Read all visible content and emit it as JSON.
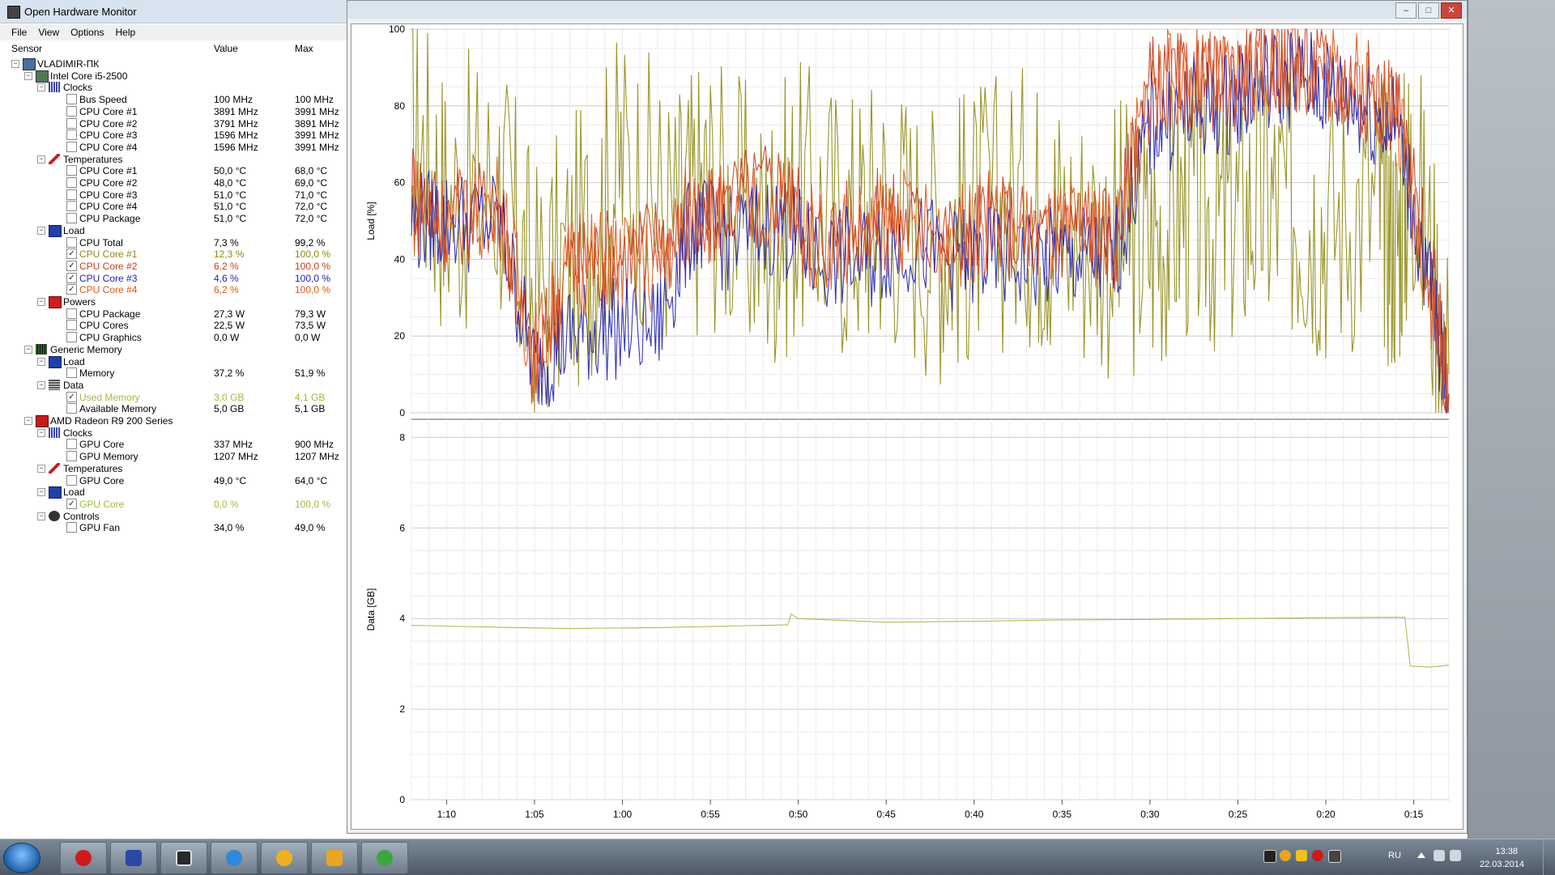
{
  "window": {
    "title": "Open Hardware Monitor"
  },
  "menu": [
    "File",
    "View",
    "Options",
    "Help"
  ],
  "columns": {
    "sensor": "Sensor",
    "value": "Value",
    "max": "Max"
  },
  "tree": [
    {
      "level": 0,
      "kind": "node",
      "icon": "computer-icon",
      "label": "VLADIMIR-ПК",
      "value": "",
      "max": ""
    },
    {
      "level": 1,
      "kind": "node",
      "icon": "cpu-icon",
      "label": "Intel Core i5-2500",
      "value": "",
      "max": ""
    },
    {
      "level": 2,
      "kind": "node",
      "icon": "clock-icon",
      "label": "Clocks",
      "value": "",
      "max": ""
    },
    {
      "level": 3,
      "kind": "leaf",
      "checked": false,
      "color": "",
      "label": "Bus Speed",
      "value": "100 MHz",
      "max": "100 MHz"
    },
    {
      "level": 3,
      "kind": "leaf",
      "checked": false,
      "color": "",
      "label": "CPU Core #1",
      "value": "3891 MHz",
      "max": "3991 MHz"
    },
    {
      "level": 3,
      "kind": "leaf",
      "checked": false,
      "color": "",
      "label": "CPU Core #2",
      "value": "3791 MHz",
      "max": "3891 MHz"
    },
    {
      "level": 3,
      "kind": "leaf",
      "checked": false,
      "color": "",
      "label": "CPU Core #3",
      "value": "1596 MHz",
      "max": "3991 MHz"
    },
    {
      "level": 3,
      "kind": "leaf",
      "checked": false,
      "color": "",
      "label": "CPU Core #4",
      "value": "1596 MHz",
      "max": "3991 MHz"
    },
    {
      "level": 2,
      "kind": "node",
      "icon": "thermometer-icon",
      "label": "Temperatures",
      "value": "",
      "max": ""
    },
    {
      "level": 3,
      "kind": "leaf",
      "checked": false,
      "color": "",
      "label": "CPU Core #1",
      "value": "50,0 °C",
      "max": "68,0 °C"
    },
    {
      "level": 3,
      "kind": "leaf",
      "checked": false,
      "color": "",
      "label": "CPU Core #2",
      "value": "48,0 °C",
      "max": "69,0 °C"
    },
    {
      "level": 3,
      "kind": "leaf",
      "checked": false,
      "color": "",
      "label": "CPU Core #3",
      "value": "51,0 °C",
      "max": "71,0 °C"
    },
    {
      "level": 3,
      "kind": "leaf",
      "checked": false,
      "color": "",
      "label": "CPU Core #4",
      "value": "51,0 °C",
      "max": "72,0 °C"
    },
    {
      "level": 3,
      "kind": "leaf",
      "checked": false,
      "color": "",
      "label": "CPU Package",
      "value": "51,0 °C",
      "max": "72,0 °C"
    },
    {
      "level": 2,
      "kind": "node",
      "icon": "load-icon",
      "label": "Load",
      "value": "",
      "max": ""
    },
    {
      "level": 3,
      "kind": "leaf",
      "checked": false,
      "color": "",
      "label": "CPU Total",
      "value": "7,3 %",
      "max": "99,2 %"
    },
    {
      "level": 3,
      "kind": "leaf",
      "checked": true,
      "color": "#8f8a12",
      "label": "CPU Core #1",
      "value": "12,3 %",
      "max": "100,0 %"
    },
    {
      "level": 3,
      "kind": "leaf",
      "checked": true,
      "color": "#c83b1e",
      "label": "CPU Core #2",
      "value": "6,2 %",
      "max": "100,0 %"
    },
    {
      "level": 3,
      "kind": "leaf",
      "checked": true,
      "color": "#2222b0",
      "label": "CPU Core #3",
      "value": "4,6 %",
      "max": "100,0 %"
    },
    {
      "level": 3,
      "kind": "leaf",
      "checked": true,
      "color": "#e0561a",
      "label": "CPU Core #4",
      "value": "6,2 %",
      "max": "100,0 %"
    },
    {
      "level": 2,
      "kind": "node",
      "icon": "power-icon",
      "label": "Powers",
      "value": "",
      "max": ""
    },
    {
      "level": 3,
      "kind": "leaf",
      "checked": false,
      "color": "",
      "label": "CPU Package",
      "value": "27,3 W",
      "max": "79,3 W"
    },
    {
      "level": 3,
      "kind": "leaf",
      "checked": false,
      "color": "",
      "label": "CPU Cores",
      "value": "22,5 W",
      "max": "73,5 W"
    },
    {
      "level": 3,
      "kind": "leaf",
      "checked": false,
      "color": "",
      "label": "CPU Graphics",
      "value": "0,0 W",
      "max": "0,0 W"
    },
    {
      "level": 1,
      "kind": "node",
      "icon": "ram-icon",
      "label": "Generic Memory",
      "value": "",
      "max": ""
    },
    {
      "level": 2,
      "kind": "node",
      "icon": "load-icon",
      "label": "Load",
      "value": "",
      "max": ""
    },
    {
      "level": 3,
      "kind": "leaf",
      "checked": false,
      "color": "",
      "label": "Memory",
      "value": "37,2 %",
      "max": "51,9 %"
    },
    {
      "level": 2,
      "kind": "node",
      "icon": "data-icon",
      "label": "Data",
      "value": "",
      "max": ""
    },
    {
      "level": 3,
      "kind": "leaf",
      "checked": true,
      "color": "#9bbd3c",
      "label": "Used Memory",
      "value": "3,0 GB",
      "max": "4,1 GB"
    },
    {
      "level": 3,
      "kind": "leaf",
      "checked": false,
      "color": "",
      "label": "Available Memory",
      "value": "5,0 GB",
      "max": "5,1 GB"
    },
    {
      "level": 1,
      "kind": "node",
      "icon": "ati-icon",
      "label": "AMD Radeon R9 200 Series",
      "value": "",
      "max": ""
    },
    {
      "level": 2,
      "kind": "node",
      "icon": "clock-icon",
      "label": "Clocks",
      "value": "",
      "max": ""
    },
    {
      "level": 3,
      "kind": "leaf",
      "checked": false,
      "color": "",
      "label": "GPU Core",
      "value": "337 MHz",
      "max": "900 MHz"
    },
    {
      "level": 3,
      "kind": "leaf",
      "checked": false,
      "color": "",
      "label": "GPU Memory",
      "value": "1207 MHz",
      "max": "1207 MHz"
    },
    {
      "level": 2,
      "kind": "node",
      "icon": "thermometer-icon",
      "label": "Temperatures",
      "value": "",
      "max": ""
    },
    {
      "level": 3,
      "kind": "leaf",
      "checked": false,
      "color": "",
      "label": "GPU Core",
      "value": "49,0 °C",
      "max": "64,0 °C"
    },
    {
      "level": 2,
      "kind": "node",
      "icon": "load-icon",
      "label": "Load",
      "value": "",
      "max": ""
    },
    {
      "level": 3,
      "kind": "leaf",
      "checked": true,
      "color": "#9bbd3c",
      "label": "GPU Core",
      "value": "0,0 %",
      "max": "100,0 %"
    },
    {
      "level": 2,
      "kind": "node",
      "icon": "fan-icon",
      "label": "Controls",
      "value": "",
      "max": ""
    },
    {
      "level": 3,
      "kind": "leaf",
      "checked": false,
      "color": "",
      "label": "GPU Fan",
      "value": "34,0 %",
      "max": "49,0 %"
    }
  ],
  "chart_data": [
    {
      "type": "line",
      "title": "",
      "ylabel": "Load [%]",
      "ylim": [
        0,
        100
      ],
      "yticks": [
        0,
        20,
        40,
        60,
        80,
        100
      ],
      "xlabel": "",
      "x_ticks": [
        "1:10",
        "1:05",
        "1:00",
        "0:55",
        "0:50",
        "0:45",
        "0:40",
        "0:35",
        "0:30",
        "0:25",
        "0:20",
        "0:15"
      ],
      "x_range_minutes": [
        72,
        13
      ],
      "segments_note_free": true,
      "series": [
        {
          "name": "CPU Core #1",
          "color": "#8f8a12",
          "segments": [
            [
              72,
              75
            ],
            [
              70,
              55
            ],
            [
              67,
              60
            ],
            [
              65,
              30
            ],
            [
              62,
              45
            ],
            [
              60,
              65
            ],
            [
              57,
              50
            ],
            [
              55,
              60
            ],
            [
              52,
              45
            ],
            [
              50,
              55
            ],
            [
              47,
              50
            ],
            [
              45,
              55
            ],
            [
              42,
              45
            ],
            [
              40,
              50
            ],
            [
              37,
              55
            ],
            [
              35,
              50
            ],
            [
              32,
              45
            ],
            [
              30,
              45
            ],
            [
              28,
              55
            ],
            [
              26,
              50
            ],
            [
              24,
              55
            ],
            [
              22,
              55
            ],
            [
              20,
              50
            ],
            [
              17,
              55
            ],
            [
              16,
              45
            ],
            [
              15,
              65
            ],
            [
              13,
              10
            ]
          ]
        },
        {
          "name": "CPU Core #2",
          "color": "#c83b1e",
          "segments": [
            [
              72,
              60
            ],
            [
              70,
              50
            ],
            [
              67,
              55
            ],
            [
              65,
              10
            ],
            [
              63,
              40
            ],
            [
              61,
              40
            ],
            [
              58,
              45
            ],
            [
              56,
              45
            ],
            [
              54,
              55
            ],
            [
              51,
              60
            ],
            [
              49,
              45
            ],
            [
              46,
              50
            ],
            [
              44,
              50
            ],
            [
              41,
              45
            ],
            [
              39,
              50
            ],
            [
              36,
              45
            ],
            [
              34,
              50
            ],
            [
              32,
              45
            ],
            [
              30,
              85
            ],
            [
              28,
              85
            ],
            [
              26,
              85
            ],
            [
              24,
              90
            ],
            [
              22,
              92
            ],
            [
              20,
              88
            ],
            [
              18,
              85
            ],
            [
              16,
              80
            ],
            [
              14,
              35
            ],
            [
              13,
              5
            ]
          ]
        },
        {
          "name": "CPU Core #3",
          "color": "#2222b0",
          "segments": [
            [
              72,
              50
            ],
            [
              70,
              50
            ],
            [
              67,
              50
            ],
            [
              65,
              12
            ],
            [
              63,
              20
            ],
            [
              61,
              22
            ],
            [
              58,
              22
            ],
            [
              56,
              50
            ],
            [
              54,
              45
            ],
            [
              51,
              50
            ],
            [
              49,
              40
            ],
            [
              46,
              40
            ],
            [
              44,
              45
            ],
            [
              41,
              40
            ],
            [
              39,
              40
            ],
            [
              36,
              40
            ],
            [
              34,
              40
            ],
            [
              32,
              40
            ],
            [
              30,
              75
            ],
            [
              28,
              78
            ],
            [
              26,
              80
            ],
            [
              24,
              85
            ],
            [
              22,
              88
            ],
            [
              20,
              85
            ],
            [
              18,
              80
            ],
            [
              16,
              75
            ],
            [
              14,
              30
            ],
            [
              13,
              5
            ]
          ]
        },
        {
          "name": "CPU Core #4",
          "color": "#e0561a",
          "segments": [
            [
              72,
              55
            ],
            [
              70,
              50
            ],
            [
              67,
              55
            ],
            [
              65,
              15
            ],
            [
              63,
              38
            ],
            [
              61,
              40
            ],
            [
              58,
              38
            ],
            [
              56,
              55
            ],
            [
              54,
              50
            ],
            [
              51,
              55
            ],
            [
              49,
              45
            ],
            [
              46,
              48
            ],
            [
              44,
              50
            ],
            [
              41,
              45
            ],
            [
              39,
              50
            ],
            [
              36,
              45
            ],
            [
              34,
              48
            ],
            [
              32,
              45
            ],
            [
              30,
              85
            ],
            [
              28,
              88
            ],
            [
              26,
              85
            ],
            [
              24,
              90
            ],
            [
              22,
              92
            ],
            [
              20,
              90
            ],
            [
              18,
              85
            ],
            [
              16,
              80
            ],
            [
              14,
              30
            ],
            [
              13,
              5
            ]
          ]
        }
      ]
    },
    {
      "type": "line",
      "title": "",
      "ylabel": "Data [GB]",
      "ylim": [
        0,
        8.4
      ],
      "yticks": [
        0,
        2,
        4,
        6,
        8
      ],
      "x_ticks": [
        "1:10",
        "1:05",
        "1:00",
        "0:55",
        "0:50",
        "0:45",
        "0:40",
        "0:35",
        "0:30",
        "0:25",
        "0:20",
        "0:15"
      ],
      "x_range_minutes": [
        72,
        13
      ],
      "series": [
        {
          "name": "Used Memory",
          "color": "#9bbd3c",
          "segments": [
            [
              72,
              3.85
            ],
            [
              66,
              3.8
            ],
            [
              63,
              3.78
            ],
            [
              58,
              3.8
            ],
            [
              52,
              3.85
            ],
            [
              50.6,
              3.86
            ],
            [
              50.4,
              4.1
            ],
            [
              50,
              4.0
            ],
            [
              45,
              3.92
            ],
            [
              40,
              3.94
            ],
            [
              35,
              3.97
            ],
            [
              30,
              3.98
            ],
            [
              25,
              4.0
            ],
            [
              20,
              4.02
            ],
            [
              15.5,
              4.03
            ],
            [
              15.2,
              2.95
            ],
            [
              14,
              2.93
            ],
            [
              13,
              2.97
            ]
          ]
        }
      ]
    }
  ],
  "taskbar": {
    "apps": [
      "opera-icon",
      "save-icon",
      "ohm-icon",
      "browser-icon",
      "radioactive-icon",
      "avast-icon",
      "xbox-icon"
    ],
    "tray_icons": [
      "monitor-icon",
      "radioactive-icon",
      "avast-icon",
      "opera-icon",
      "ohm-icon"
    ],
    "language": "RU",
    "time": "13:38",
    "date": "22.03.2014"
  }
}
